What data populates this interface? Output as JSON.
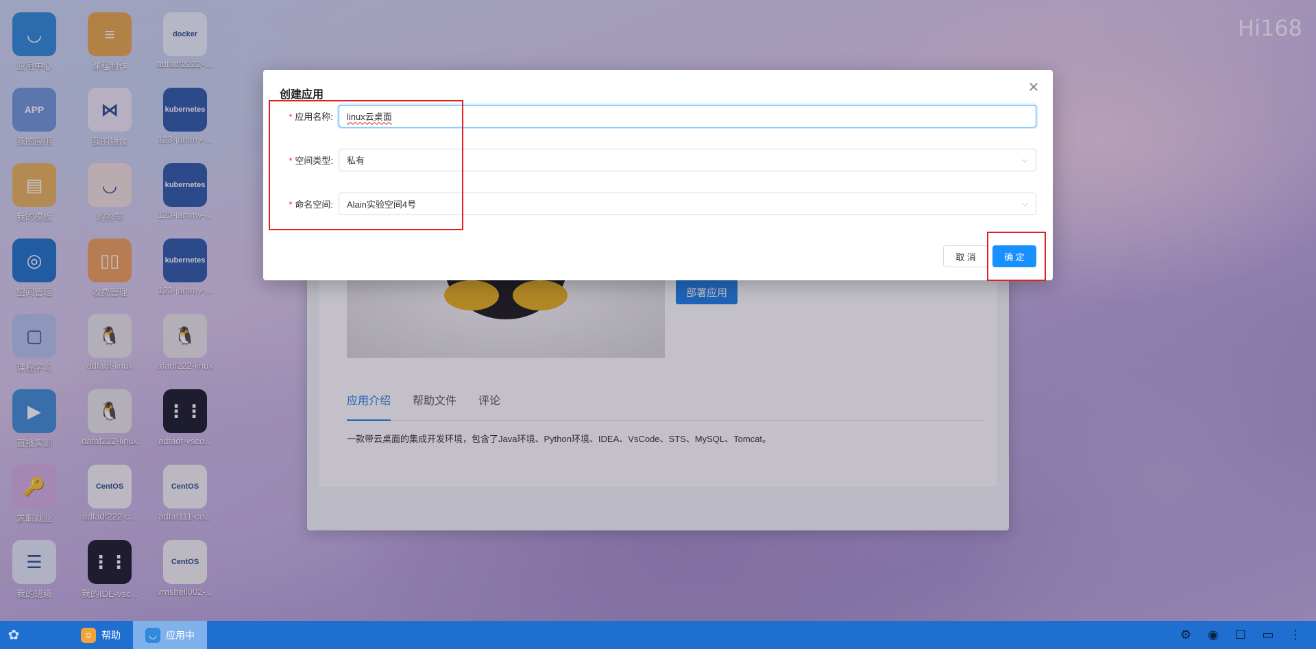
{
  "desktop": {
    "brand": "Hi168",
    "icons": [
      {
        "label": "应用中心",
        "glyph": "◡",
        "color": "#2f8ad8"
      },
      {
        "label": "课程制作",
        "glyph": "≡",
        "color": "#e8a84a"
      },
      {
        "label": "adfadf2222-j...",
        "glyph": "docker",
        "color": "#eef3fb"
      },
      {
        "label": "我的应用",
        "glyph": "APP",
        "color": "#6f99d8"
      },
      {
        "label": "我的镜像",
        "glyph": "⋈",
        "color": "#efe9f7"
      },
      {
        "label": "123-jammy-...",
        "glyph": "kubernetes",
        "color": "#2e5aa8"
      },
      {
        "label": "我的模板",
        "glyph": "▤",
        "color": "#e9b65a"
      },
      {
        "label": "购物车",
        "glyph": "◡",
        "color": "#f1e2dc"
      },
      {
        "label": "123-jammy-...",
        "glyph": "kubernetes",
        "color": "#2e5aa8"
      },
      {
        "label": "空间管理",
        "glyph": "◎",
        "color": "#1f74c9"
      },
      {
        "label": "收费管理",
        "glyph": "▯▯",
        "color": "#f0a15a"
      },
      {
        "label": "123-jammy-...",
        "glyph": "kubernetes",
        "color": "#2e5aa8"
      },
      {
        "label": "课程学习",
        "glyph": "▢",
        "color": "#b6c6ec"
      },
      {
        "label": "adfadf-linux",
        "glyph": "🐧",
        "color": "#e8e8e8"
      },
      {
        "label": "afadf222-linux",
        "glyph": "🐧",
        "color": "#e8e8e8"
      },
      {
        "label": "直播实训",
        "glyph": "▶",
        "color": "#3f8fd6"
      },
      {
        "label": "dafaf222-linux",
        "glyph": "🐧",
        "color": "#e8e8e8"
      },
      {
        "label": "adfadf-vsco...",
        "glyph": "⋮⋮",
        "color": "#1b1e2a"
      },
      {
        "label": "求职就业",
        "glyph": "🔑",
        "color": "#d5b1e0"
      },
      {
        "label": "adfadf222-c...",
        "glyph": "CentOS",
        "color": "#f4f4f4"
      },
      {
        "label": "adfaf111-ce...",
        "glyph": "CentOS",
        "color": "#f4f4f4"
      },
      {
        "label": "我的班级",
        "glyph": "☰",
        "color": "#e5ecf9"
      },
      {
        "label": "我的IDE-vsc...",
        "glyph": "⋮⋮",
        "color": "#1b1e2a"
      },
      {
        "label": "vmshell002-...",
        "glyph": "CentOS",
        "color": "#f4f4f4"
      }
    ]
  },
  "app_window": {
    "deploy_label": "部署应用",
    "tabs": [
      "应用介绍",
      "帮助文件",
      "评论"
    ],
    "intro": "一款带云桌面的集成开发环境，包含了Java环境、Python环境、IDEA、VsCode、STS、MySQL、Tomcat。"
  },
  "modal": {
    "title": "创建应用",
    "close_icon": "close-icon",
    "fields": [
      {
        "label": "应用名称:",
        "value": "linux云桌面"
      },
      {
        "label": "空间类型:",
        "value": "私有"
      },
      {
        "label": "命名空间:",
        "value": "Alain实验空间4号"
      }
    ],
    "cancel_label": "取 消",
    "ok_label": "确 定"
  },
  "taskbar": {
    "items": [
      "帮助",
      "应用中"
    ]
  },
  "colors": {
    "accent": "#1890ff",
    "taskbar": "#1e6fd0",
    "annotation": "#e02020"
  }
}
